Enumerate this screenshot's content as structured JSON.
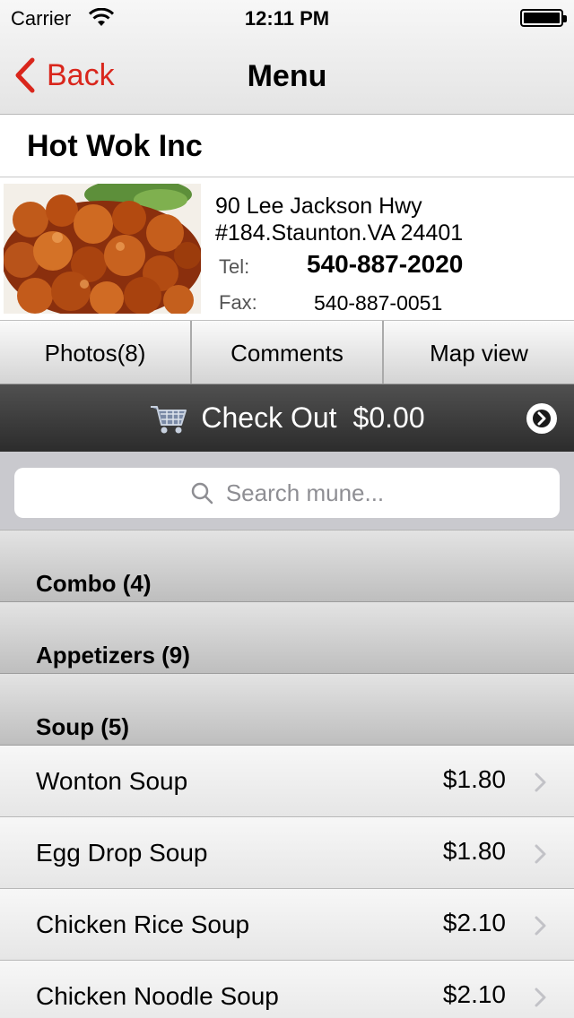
{
  "status_bar": {
    "carrier": "Carrier",
    "time": "12:11 PM"
  },
  "nav": {
    "back_label": "Back",
    "title": "Menu"
  },
  "restaurant": {
    "name": "Hot Wok Inc",
    "address_line1": "90 Lee Jackson Hwy",
    "address_line2": "#184.Staunton.VA 24401",
    "tel_label": "Tel:",
    "tel": "540-887-2020",
    "fax_label": "Fax:",
    "fax": "540-887-0051"
  },
  "tabs": [
    {
      "label": "Photos(8)"
    },
    {
      "label": "Comments"
    },
    {
      "label": "Map view"
    }
  ],
  "checkout": {
    "label": "Check Out",
    "total": "$0.00"
  },
  "search": {
    "placeholder": "Search mune..."
  },
  "sections": [
    {
      "label": "Combo (4)"
    },
    {
      "label": "Appetizers (9)"
    },
    {
      "label": "Soup (5)"
    }
  ],
  "items": [
    {
      "name": "Wonton Soup",
      "price": "$1.80"
    },
    {
      "name": "Egg Drop Soup",
      "price": "$1.80"
    },
    {
      "name": "Chicken Rice Soup",
      "price": "$2.10"
    },
    {
      "name": "Chicken Noodle Soup",
      "price": "$2.10"
    }
  ],
  "colors": {
    "accent": "#d9261c",
    "checkout_bar": "#3a3a3a",
    "search_bg": "#c9c9ce"
  }
}
